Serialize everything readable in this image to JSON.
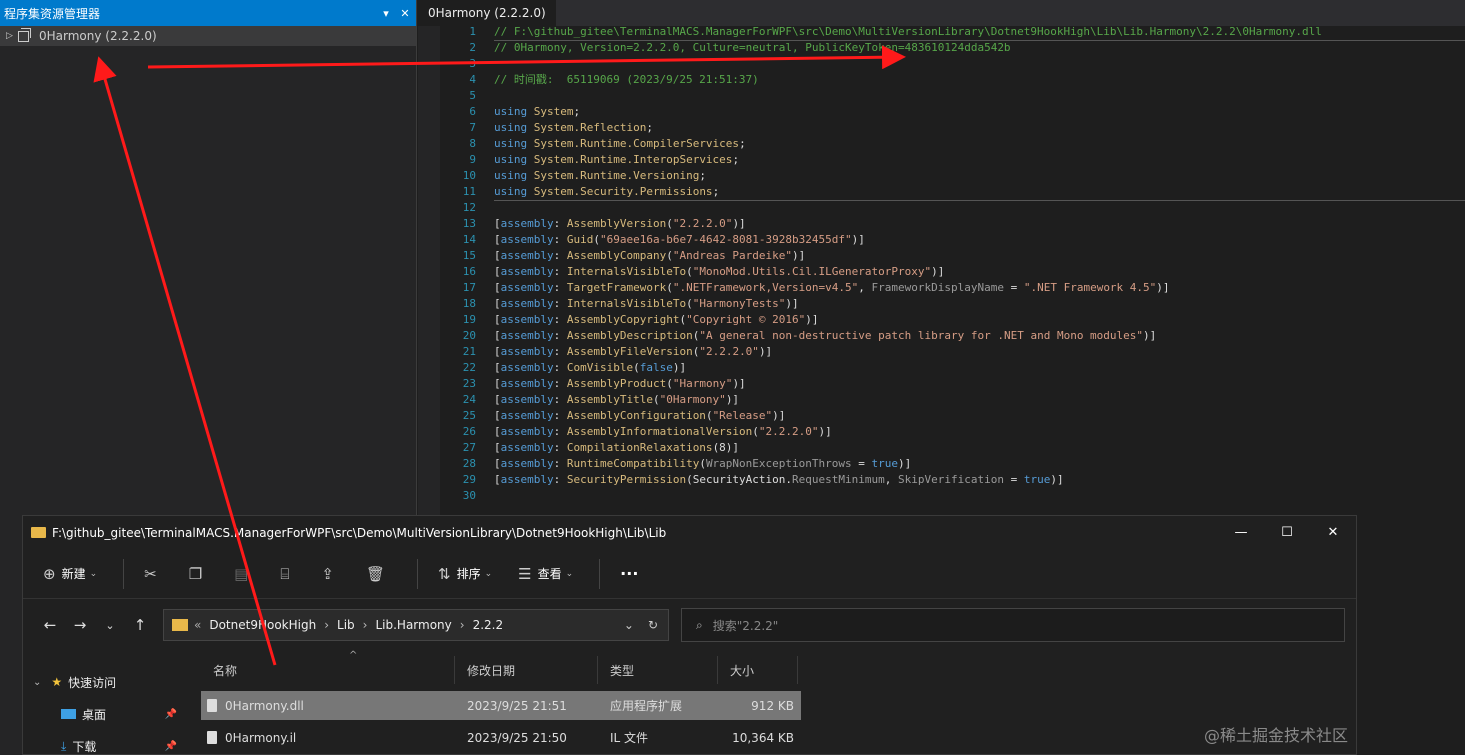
{
  "assembly_panel": {
    "title": "程序集资源管理器",
    "pin_icon": "▾",
    "close_icon": "✕",
    "tree_item": "0Harmony (2.2.2.0)"
  },
  "editor": {
    "tab": "0Harmony (2.2.2.0)",
    "lines": [
      {
        "n": "1",
        "t": "comment",
        "text": "// F:\\github_gitee\\TerminalMACS.ManagerForWPF\\src\\Demo\\MultiVersionLibrary\\Dotnet9HookHigh\\Lib\\Lib.Harmony\\2.2.2\\0Harmony.dll"
      },
      {
        "n": "2",
        "t": "comment",
        "text": "// 0Harmony, Version=2.2.2.0, Culture=neutral, PublicKeyToken=483610124dda542b"
      },
      {
        "n": "3",
        "t": "plain",
        "text": ""
      },
      {
        "n": "4",
        "t": "comment",
        "text": "// 时间戳:  65119069 (2023/9/25 21:51:37)"
      },
      {
        "n": "5",
        "t": "plain",
        "text": ""
      },
      {
        "n": "6",
        "t": "using",
        "ns": "System"
      },
      {
        "n": "7",
        "t": "using",
        "ns": "System.Reflection"
      },
      {
        "n": "8",
        "t": "using",
        "ns": "System.Runtime.CompilerServices"
      },
      {
        "n": "9",
        "t": "using",
        "ns": "System.Runtime.InteropServices"
      },
      {
        "n": "10",
        "t": "using",
        "ns": "System.Runtime.Versioning"
      },
      {
        "n": "11",
        "t": "using",
        "ns": "System.Security.Permissions"
      },
      {
        "n": "12",
        "t": "plain",
        "text": ""
      },
      {
        "n": "13",
        "t": "attr",
        "name": "AssemblyVersion",
        "args": "(\"2.2.2.0\")]"
      },
      {
        "n": "14",
        "t": "attr",
        "name": "Guid",
        "args": "(\"69aee16a-b6e7-4642-8081-3928b32455df\")]"
      },
      {
        "n": "15",
        "t": "attr",
        "name": "AssemblyCompany",
        "args": "(\"Andreas Pardeike\")]"
      },
      {
        "n": "16",
        "t": "attr",
        "name": "InternalsVisibleTo",
        "args": "(\"MonoMod.Utils.Cil.ILGeneratorProxy\")]"
      },
      {
        "n": "17",
        "t": "attr",
        "name": "TargetFramework",
        "args": "(\".NETFramework,Version=v4.5\", FrameworkDisplayName = \".NET Framework 4.5\")]"
      },
      {
        "n": "18",
        "t": "attr",
        "name": "InternalsVisibleTo",
        "args": "(\"HarmonyTests\")]"
      },
      {
        "n": "19",
        "t": "attr",
        "name": "AssemblyCopyright",
        "args": "(\"Copyright © 2016\")]"
      },
      {
        "n": "20",
        "t": "attr",
        "name": "AssemblyDescription",
        "args": "(\"A general non-destructive patch library for .NET and Mono modules\")]"
      },
      {
        "n": "21",
        "t": "attr",
        "name": "AssemblyFileVersion",
        "args": "(\"2.2.2.0\")]"
      },
      {
        "n": "22",
        "t": "attr",
        "name": "ComVisible",
        "args": "(false)]"
      },
      {
        "n": "23",
        "t": "attr",
        "name": "AssemblyProduct",
        "args": "(\"Harmony\")]"
      },
      {
        "n": "24",
        "t": "attr",
        "name": "AssemblyTitle",
        "args": "(\"0Harmony\")]"
      },
      {
        "n": "25",
        "t": "attr",
        "name": "AssemblyConfiguration",
        "args": "(\"Release\")]"
      },
      {
        "n": "26",
        "t": "attr",
        "name": "AssemblyInformationalVersion",
        "args": "(\"2.2.2.0\")]"
      },
      {
        "n": "27",
        "t": "attr",
        "name": "CompilationRelaxations",
        "args": "(8)]"
      },
      {
        "n": "28",
        "t": "attr",
        "name": "RuntimeCompatibility",
        "args": "(WrapNonExceptionThrows = true)]"
      },
      {
        "n": "29",
        "t": "attr",
        "name": "SecurityPermission",
        "args": "(SecurityAction.RequestMinimum, SkipVerification = true)]"
      },
      {
        "n": "30",
        "t": "plain",
        "text": ""
      }
    ]
  },
  "explorer": {
    "title": "F:\\github_gitee\\TerminalMACS.ManagerForWPF\\src\\Demo\\MultiVersionLibrary\\Dotnet9HookHigh\\Lib\\Lib",
    "toolbar": {
      "new": "新建",
      "sort": "排序",
      "view": "查看",
      "more": "···"
    },
    "breadcrumb": [
      "«",
      "Dotnet9HookHigh",
      "Lib",
      "Lib.Harmony",
      "2.2.2"
    ],
    "search_placeholder": "搜索\"2.2.2\"",
    "columns": {
      "name": "名称",
      "date": "修改日期",
      "type": "类型",
      "size": "大小"
    },
    "nav": [
      {
        "label": "快速访问"
      },
      {
        "label": "桌面"
      },
      {
        "label": "下载"
      }
    ],
    "files": [
      {
        "name": "0Harmony.dll",
        "date": "2023/9/25 21:51",
        "type": "应用程序扩展",
        "size": "912 KB",
        "selected": true
      },
      {
        "name": "0Harmony.il",
        "date": "2023/9/25 21:50",
        "type": "IL 文件",
        "size": "10,364 KB",
        "selected": false
      }
    ]
  },
  "watermark": "@稀土掘金技术社区"
}
